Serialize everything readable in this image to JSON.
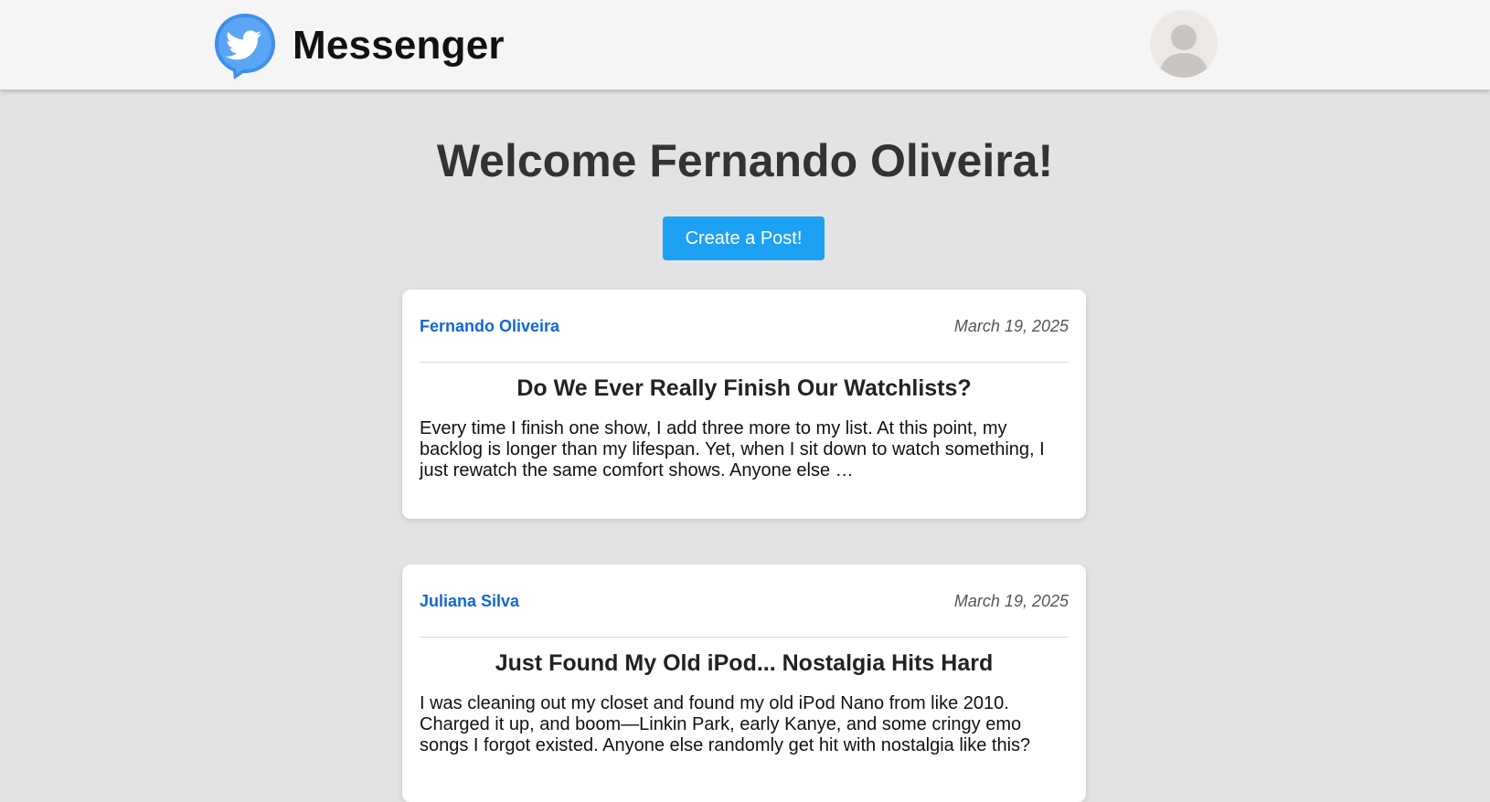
{
  "app": {
    "title": "Messenger",
    "accent_color": "#1da1f2",
    "logo_icon": "twitter-bird-chat-bubble-icon",
    "avatar_icon": "user-silhouette-icon"
  },
  "main": {
    "welcome": "Welcome Fernando Oliveira!",
    "create_post_label": "Create a Post!"
  },
  "posts": [
    {
      "author": "Fernando Oliveira",
      "date": "March 19, 2025",
      "title": "Do We Ever Really Finish Our Watchlists?",
      "body": "Every time I finish one show, I add three more to my list. At this point, my backlog is longer than my lifespan. Yet, when I sit down to watch something, I just rewatch the same comfort shows. Anyone else …"
    },
    {
      "author": "Juliana Silva",
      "date": "March 19, 2025",
      "title": "Just Found My Old iPod... Nostalgia Hits Hard",
      "body": "I was cleaning out my closet and found my old iPod Nano from like 2010. Charged it up, and boom—Linkin Park, early Kanye, and some cringy emo songs I forgot existed. Anyone else randomly get hit with nostalgia like this?"
    }
  ]
}
